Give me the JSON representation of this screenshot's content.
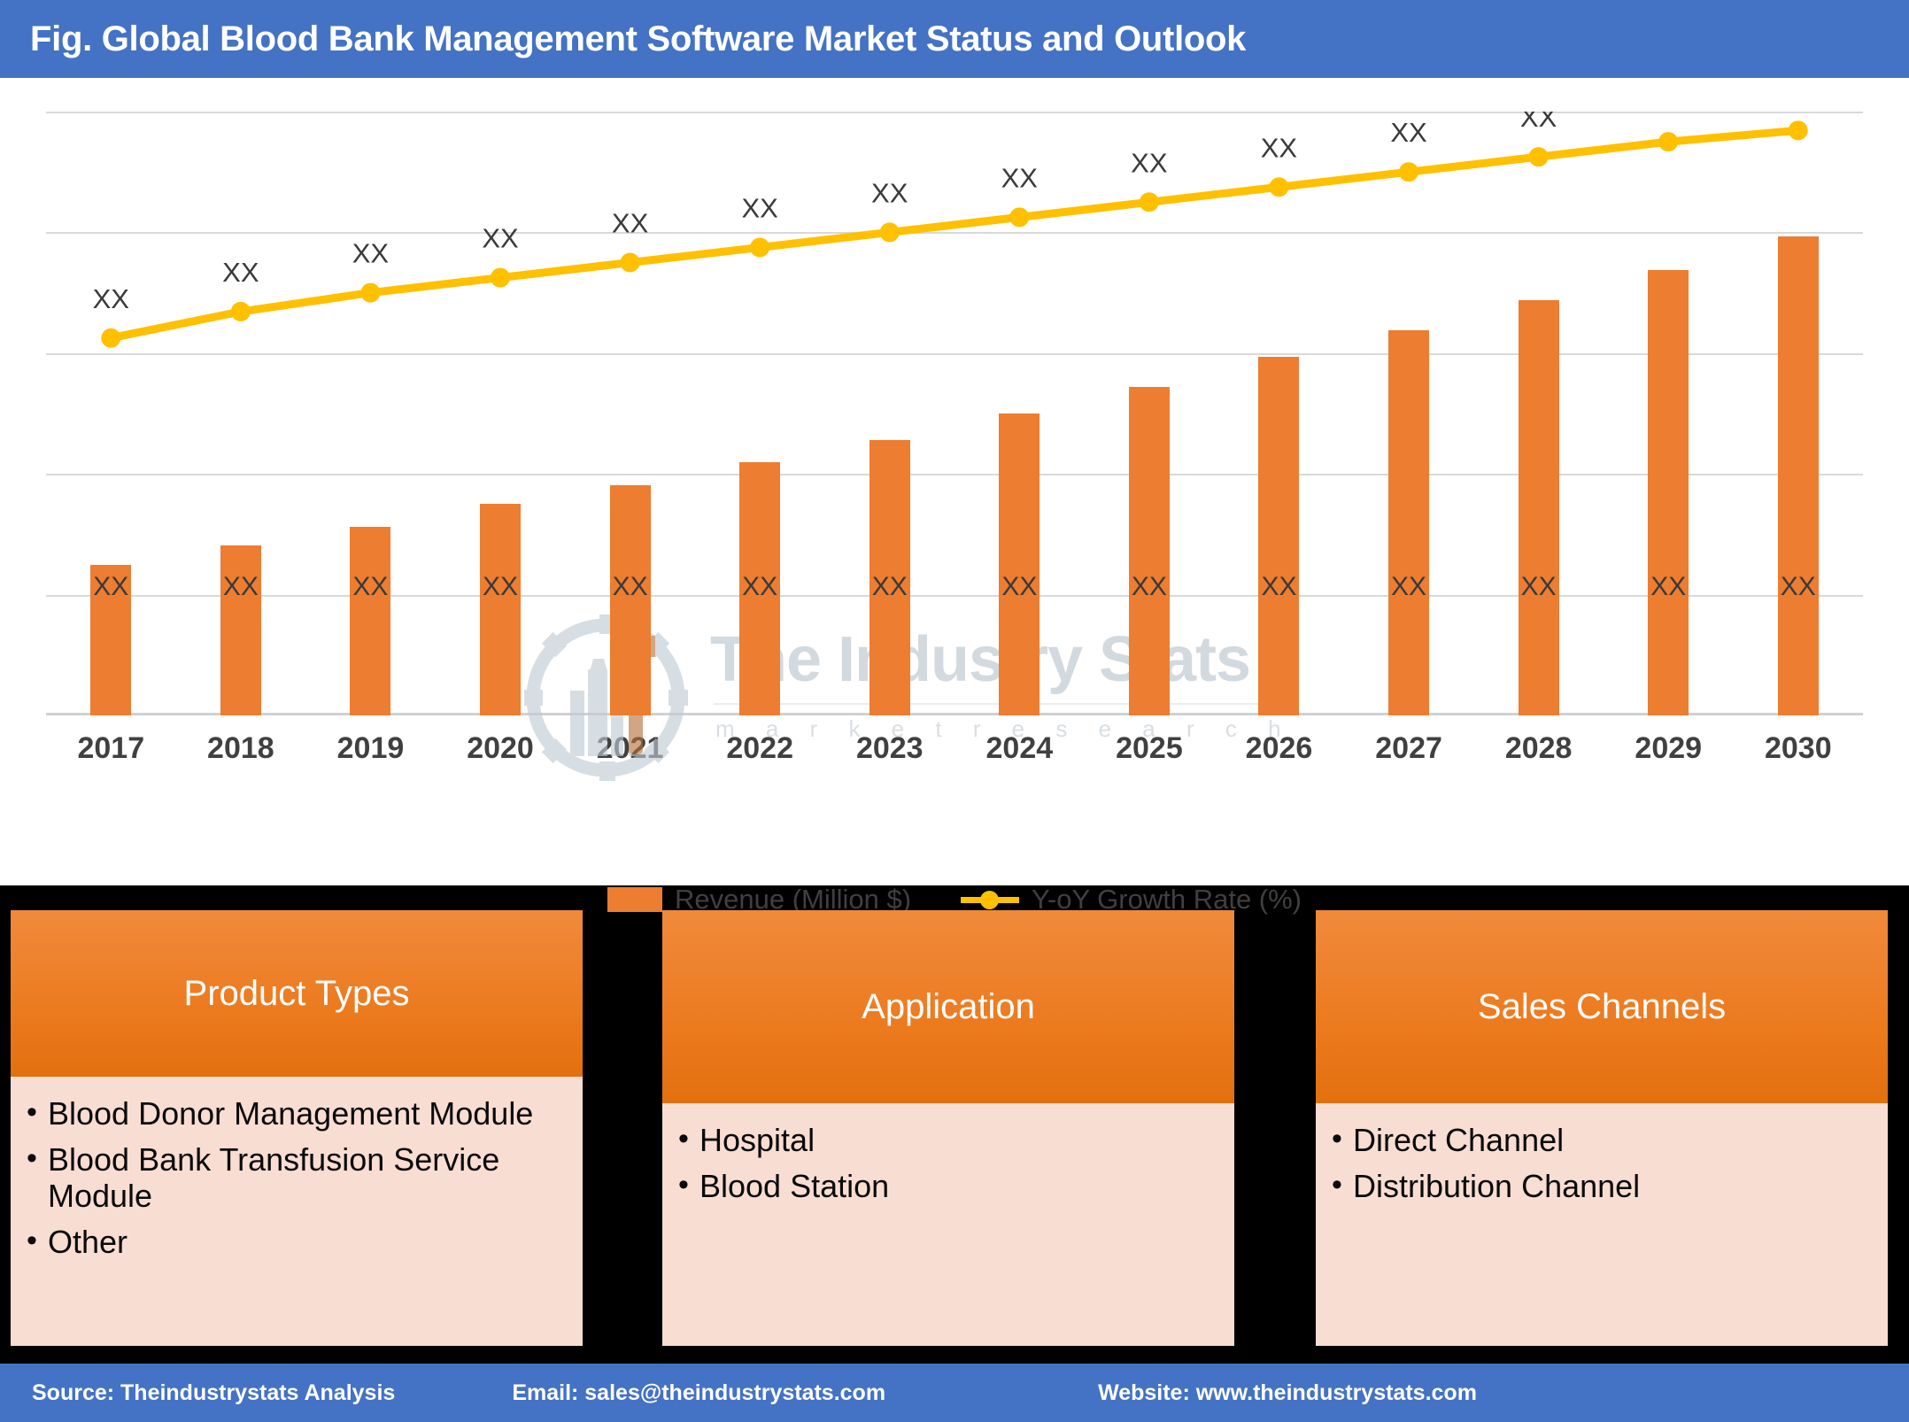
{
  "header": {
    "title": "Fig. Global Blood Bank Management Software Market Status and Outlook",
    "bg_color": "#4472C4",
    "text_color": "#FFFFFF"
  },
  "watermark": {
    "brand": "The Industry Stats",
    "tagline": "m a r k e t    r e s e a r c h"
  },
  "chart_data": {
    "type": "bar",
    "title": "Fig. Global Blood Bank Management Software Market Status and Outlook",
    "xlabel": "",
    "ylabel": "",
    "grid": true,
    "legend_position": "bottom",
    "categories": [
      "2017",
      "2018",
      "2019",
      "2020",
      "2021",
      "2022",
      "2023",
      "2024",
      "2025",
      "2026",
      "2027",
      "2028",
      "2029",
      "2030"
    ],
    "bar_color": "#ED7D31",
    "line_color": "#FFC000",
    "data_label_placeholder": "XX",
    "series": [
      {
        "name": "Revenue (Million $)",
        "type": "bar",
        "color": "#ED7D31",
        "axis": "left",
        "values": [
          40,
          45,
          50,
          56,
          61,
          67,
          73,
          80,
          87,
          95,
          102,
          110,
          118,
          127
        ],
        "value_labels": [
          "XX",
          "XX",
          "XX",
          "XX",
          "XX",
          "XX",
          "XX",
          "XX",
          "XX",
          "XX",
          "XX",
          "XX",
          "XX",
          "XX"
        ],
        "top_labels": [
          "",
          "",
          "",
          "",
          "",
          "",
          "",
          "",
          "",
          "",
          "",
          "",
          "",
          ""
        ]
      },
      {
        "name": "Y-oY Growth Rate (%)",
        "type": "line",
        "color": "#FFC000",
        "axis": "right",
        "values": [
          100,
          107,
          112,
          116,
          120,
          124,
          128,
          132,
          136,
          140,
          144,
          148,
          152,
          155
        ],
        "value_labels": [
          "XX",
          "XX",
          "XX",
          "XX",
          "XX",
          "XX",
          "XX",
          "XX",
          "XX",
          "XX",
          "XX",
          "XX",
          "XX",
          "XX"
        ]
      }
    ],
    "ylim": [
      0,
      160
    ],
    "gridline_count": 5
  },
  "legend": {
    "items": [
      {
        "label": "Revenue (Million $)",
        "marker": "bar-swatch",
        "color": "#ED7D31"
      },
      {
        "label": "Y-oY Growth Rate (%)",
        "marker": "line-marker",
        "color": "#FFC000"
      }
    ]
  },
  "segments": [
    {
      "title": "Product Types",
      "items": [
        "Blood Donor Management Module",
        "Blood Bank Transfusion Service Module",
        "Other"
      ]
    },
    {
      "title": "Application",
      "items": [
        "Hospital",
        "Blood Station"
      ]
    },
    {
      "title": "Sales Channels",
      "items": [
        "Direct Channel",
        "Distribution Channel"
      ]
    }
  ],
  "footer": {
    "source": "Source: Theindustrystats Analysis",
    "email": "Email: sales@theindustrystats.com",
    "website": "Website: www.theindustrystats.com",
    "bg_color": "#4472C4"
  }
}
